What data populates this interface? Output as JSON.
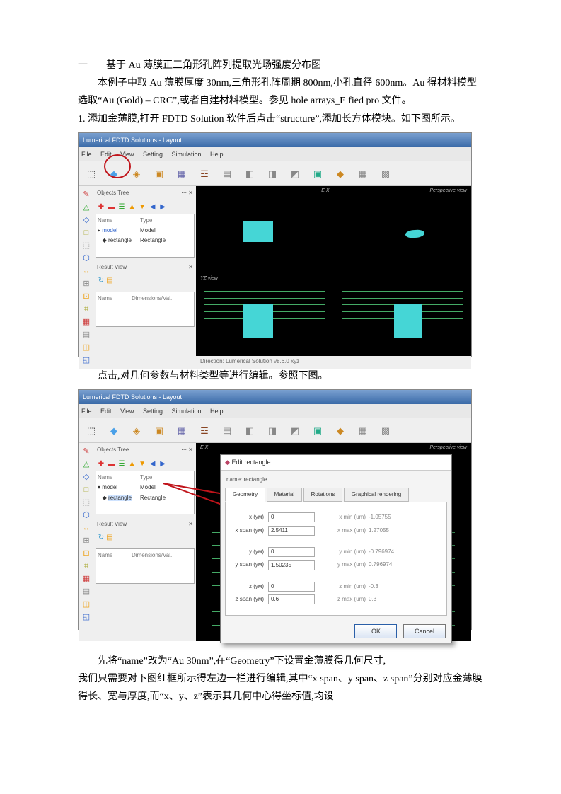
{
  "title": {
    "num": "一",
    "text": "基于 Au 薄膜正三角形孔阵列提取光场强度分布图"
  },
  "para1": "本例子中取 Au 薄膜厚度 30nm,三角形孔阵周期 800nm,小孔直径 600nm。Au 得材料模型选取“Au (Gold) – CRC”,或者自建材料模型。参见 hole arrays_E fied pro 文件。",
  "step1": "1. 添加金薄膜,打开 FDTD Solution 软件后点击“structure”,添加长方体模块。如下图所示。",
  "para2": "点击,对几何参数与材料类型等进行编辑。参照下图。",
  "para3a": "先将“name”改为“Au 30nm”,在“Geometry”下设置金薄膜得几何尺寸,",
  "para3b": "我们只需要对下图红框所示得左边一栏进行编辑,其中“x span、y span、z span”分别对应金薄膜得长、宽与厚度,而“x、y、z”表示其几何中心得坐标值,均设",
  "app": {
    "title": "Lumerical FDTD Solutions - Layout",
    "menus": [
      "File",
      "Edit",
      "View",
      "Setting",
      "Simulation",
      "Help"
    ],
    "toolbar": [
      {
        "glyph": "⬚",
        "label": "",
        "color": "#333"
      },
      {
        "glyph": "◆",
        "label": "",
        "color": "#4aa0e8"
      },
      {
        "glyph": "◈",
        "label": "",
        "color": "#cc8822"
      },
      {
        "glyph": "▣",
        "label": "",
        "color": "#cc8822"
      },
      {
        "glyph": "▦",
        "label": "",
        "color": "#6666aa"
      },
      {
        "glyph": "☲",
        "label": "",
        "color": "#884422"
      },
      {
        "glyph": "▤",
        "label": "",
        "color": "#888"
      },
      {
        "glyph": "◧",
        "label": "",
        "color": "#888"
      },
      {
        "glyph": "◨",
        "label": "",
        "color": "#888"
      },
      {
        "glyph": "◩",
        "label": "",
        "color": "#888"
      },
      {
        "glyph": "▣",
        "label": "",
        "color": "#2a8"
      },
      {
        "glyph": "◆",
        "label": "",
        "color": "#cc8822"
      },
      {
        "glyph": "▦",
        "label": "",
        "color": "#888"
      },
      {
        "glyph": "▩",
        "label": "",
        "color": "#888"
      }
    ],
    "leftIcons": [
      "✎",
      "△",
      "◇",
      "□",
      "⬚",
      "⬡",
      "↔",
      "⊞",
      "⊡",
      "⌗",
      "▦",
      "▤",
      "◫",
      "◱"
    ],
    "panel": {
      "hdr": "Objects Tree",
      "cols": [
        "Name",
        "Type"
      ],
      "items": [
        {
          "name": "model",
          "type": "Model"
        },
        {
          "name": "rectangle",
          "type": "Rectangle"
        }
      ],
      "result_hdr": "Result View",
      "result_cols": [
        "Name",
        "Dimensions/Val."
      ]
    },
    "views": {
      "tl": "E  X",
      "tr": "Perspective view",
      "bl": "YZ view",
      "br": ""
    },
    "status": "Direction: Lumerical Solution v8.6.0 xyz"
  },
  "dialog": {
    "winTitle": "Edit rectangle",
    "nameField": "name: rectangle",
    "tabs": [
      "Geometry",
      "Material",
      "Rotations",
      "Graphical rendering"
    ],
    "rows": [
      {
        "l": "x (ум)",
        "v": "0",
        "r": "x min (um)",
        "rv": "-1.05755"
      },
      {
        "l": "x span (ум)",
        "v": "2.5411",
        "r": "x max (um)",
        "rv": "1.27055"
      },
      {
        "l": "y (ум)",
        "v": "0",
        "r": "y min (um)",
        "rv": "-0.796974"
      },
      {
        "l": "y span (ум)",
        "v": "1.50235",
        "r": "y max (um)",
        "rv": "0.796974"
      },
      {
        "l": "z (ум)",
        "v": "0",
        "r": "z min (um)",
        "rv": "-0.3"
      },
      {
        "l": "z span (ум)",
        "v": "0.6",
        "r": "z max (um)",
        "rv": "0.3"
      }
    ],
    "ok": "OK",
    "cancel": "Cancel"
  }
}
